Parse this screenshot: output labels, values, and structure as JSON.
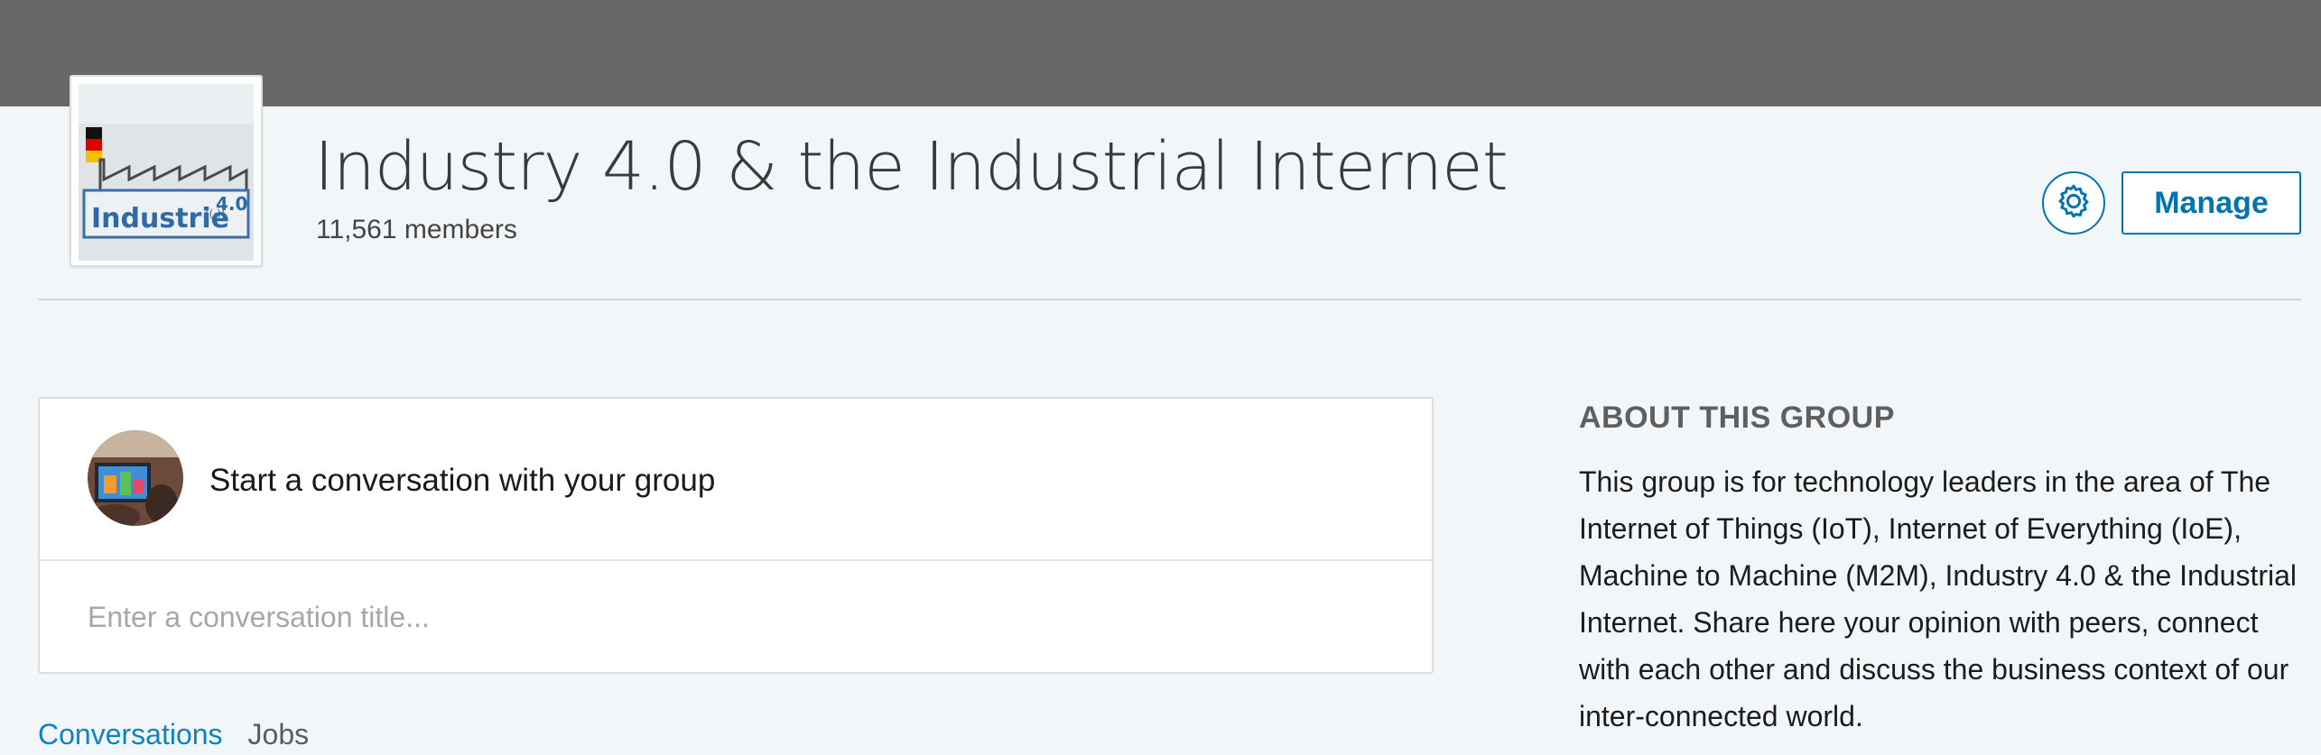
{
  "group": {
    "title": "Industry 4.0 & the Industrial Internet",
    "members": "11,561 members",
    "logo_alt": "Industrie 4.0"
  },
  "header_actions": {
    "settings_icon": "gear-icon",
    "manage_label": "Manage"
  },
  "composer": {
    "prompt": "Start a conversation with your group",
    "title_placeholder": "Enter a conversation title..."
  },
  "tabs": [
    {
      "label": "Conversations",
      "active": true
    },
    {
      "label": "Jobs",
      "active": false
    }
  ],
  "about": {
    "heading": "ABOUT THIS GROUP",
    "description": "This group is for technology leaders in the area of The Internet of Things (IoT), Internet of Everything (IoE), Machine to Machine (M2M), Industry 4.0 & the Industrial Internet. Share here your opinion with peers, connect with each other and discuss the business context of our inter-connected world."
  },
  "colors": {
    "accent": "#0073b1",
    "tab_active": "#0b84c6",
    "cover": "#686868",
    "page_bg": "#f3f6f8"
  }
}
